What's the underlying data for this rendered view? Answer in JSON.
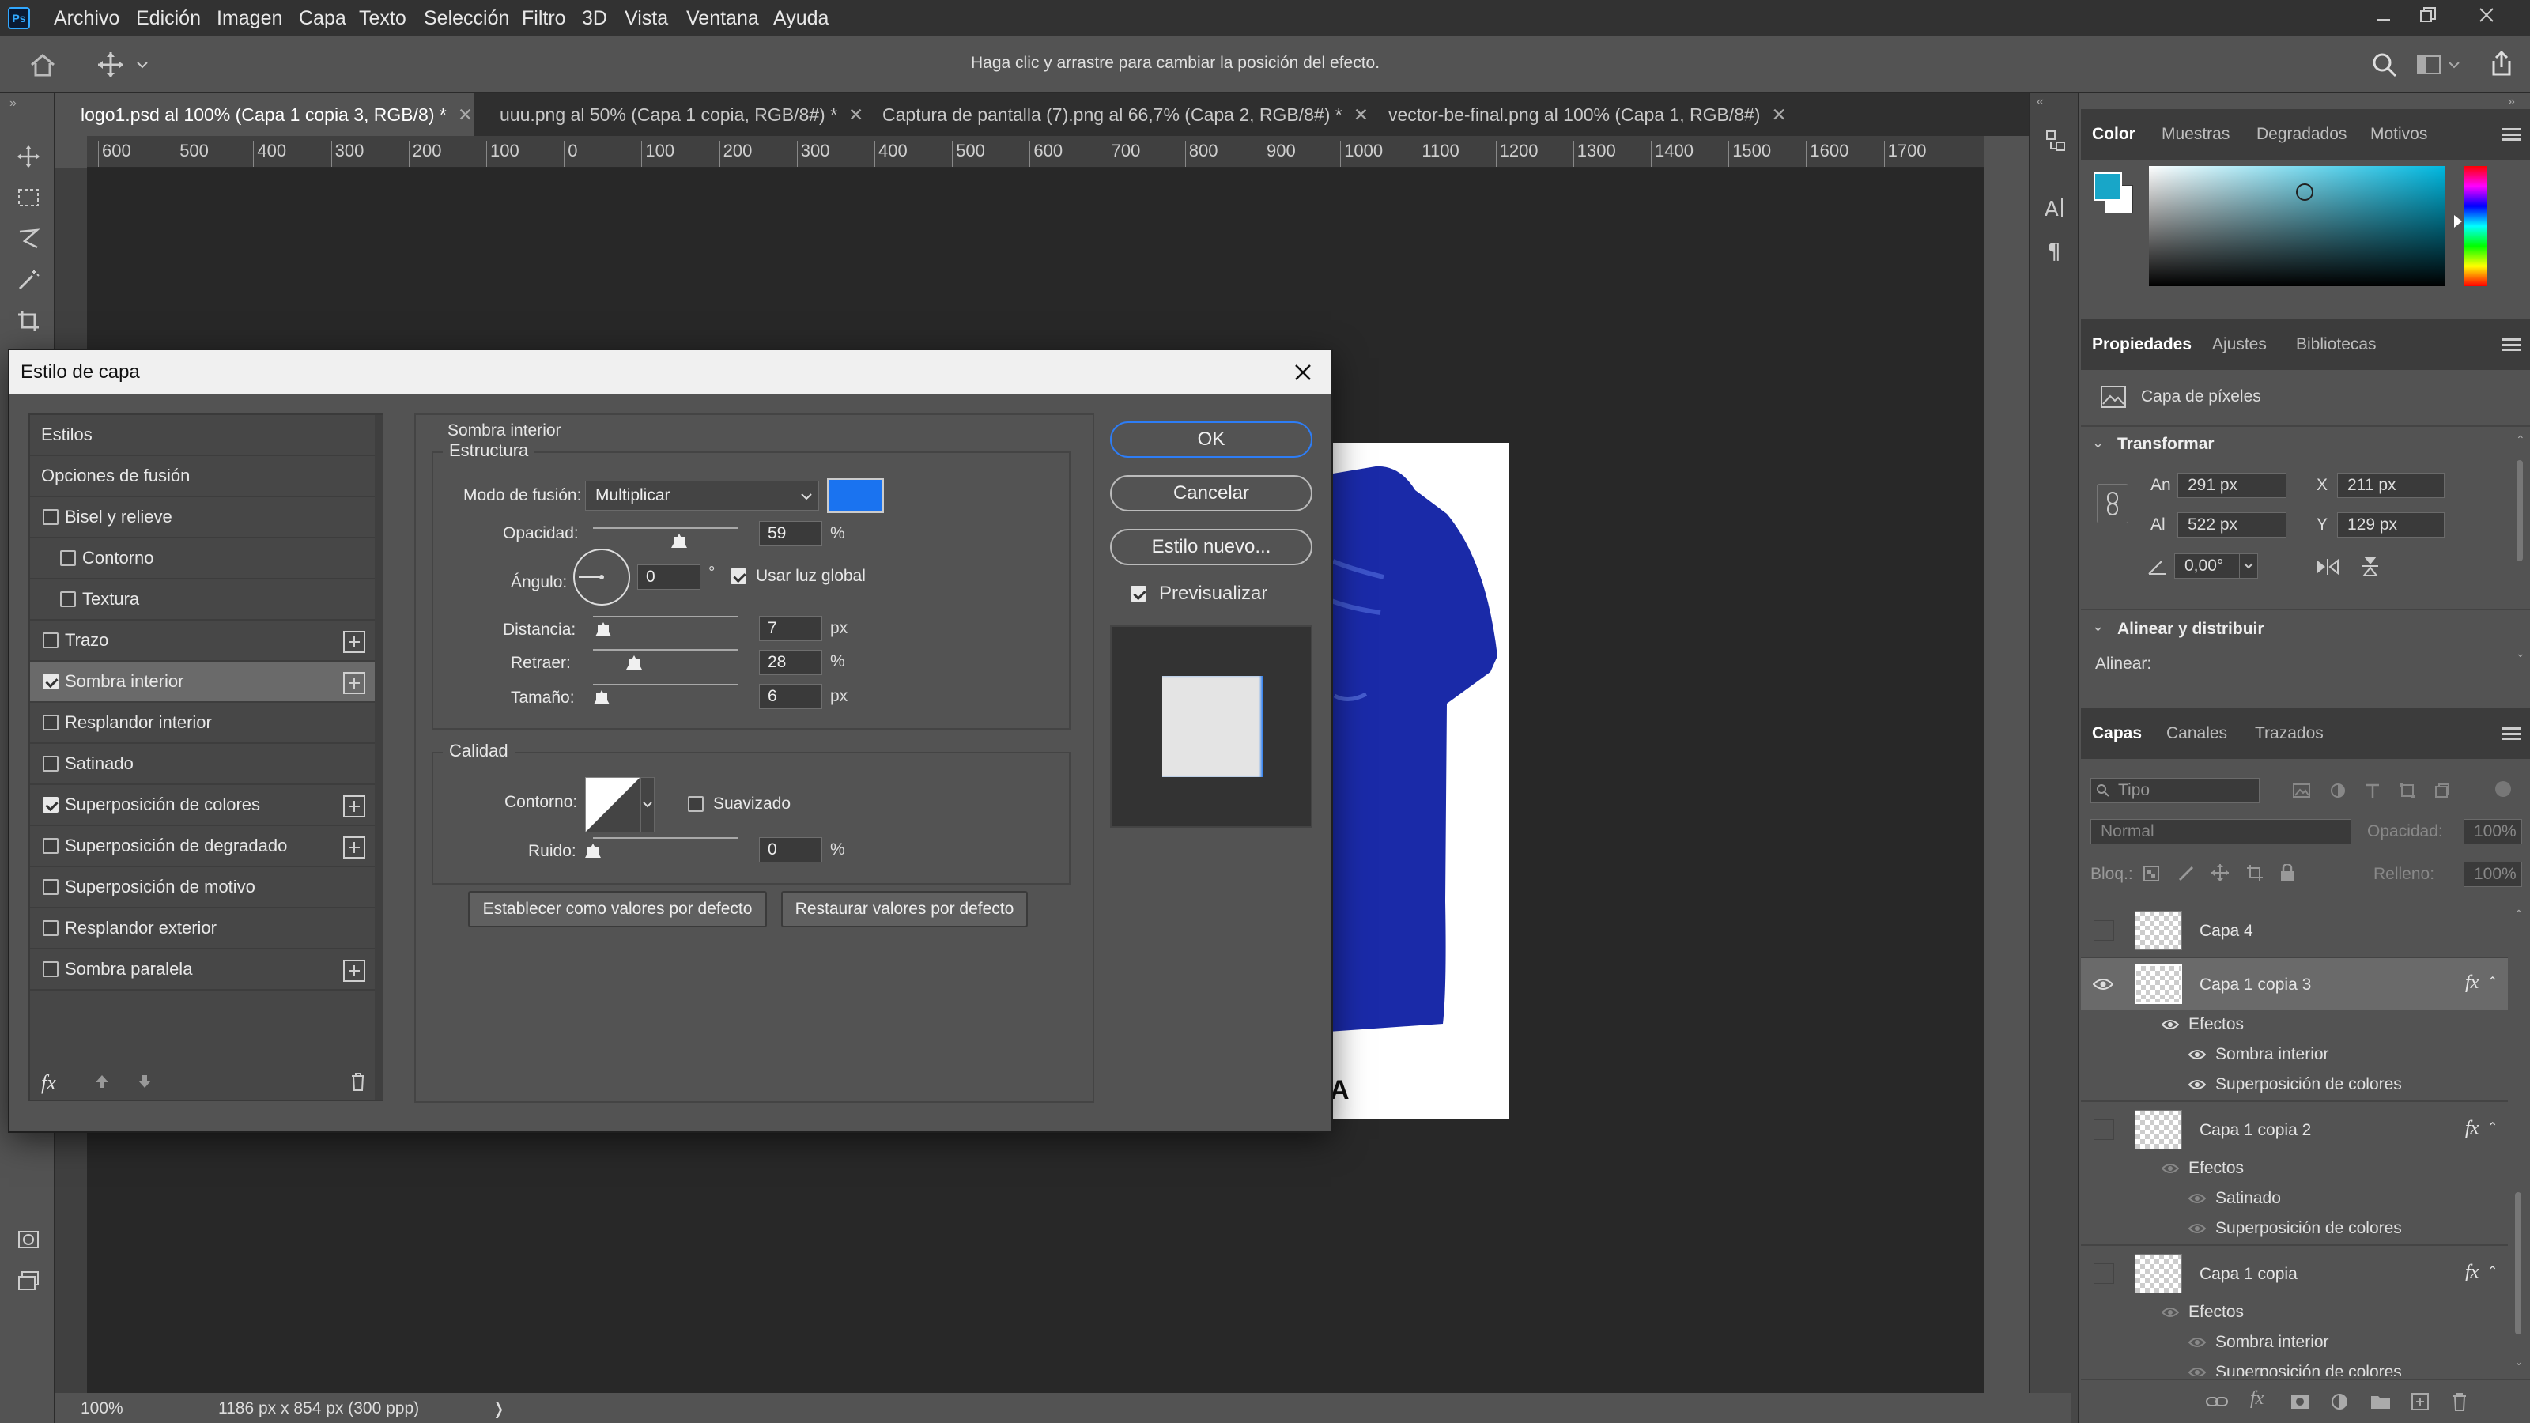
{
  "app": {
    "logo": "Ps"
  },
  "menu": [
    "Archivo",
    "Edición",
    "Imagen",
    "Capa",
    "Texto",
    "Selección",
    "Filtro",
    "3D",
    "Vista",
    "Ventana",
    "Ayuda"
  ],
  "optionsbar": {
    "hint": "Haga clic y arrastre para cambiar la posición del efecto."
  },
  "tabs": [
    "logo1.psd al 100% (Capa 1 copia 3, RGB/8) *",
    "uuu.png al 50% (Capa 1 copia, RGB/8#) *",
    "Captura de pantalla (7).png al 66,7% (Capa 2, RGB/8#) *",
    "vector-be-final.png al 100% (Capa 1, RGB/8#)"
  ],
  "ruler": {
    "h_labels": [
      "600",
      "500",
      "400",
      "300",
      "200",
      "100",
      "0",
      "100",
      "200",
      "300",
      "400",
      "500",
      "600",
      "700",
      "800",
      "900",
      "1000",
      "1100",
      "1200",
      "1300",
      "1400",
      "1500",
      "1600",
      "1700"
    ]
  },
  "status": {
    "zoom": "100%",
    "docinfo": "1186 px x 854 px (300 ppp)",
    "arrow": "❭"
  },
  "canvas_text": {
    "bottom": "A"
  },
  "color_panel": {
    "tabs": [
      "Color",
      "Muestras",
      "Degradados",
      "Motivos"
    ],
    "fg_color": "#18a6c8",
    "bg_color": "#ffffff"
  },
  "properties": {
    "tabs": [
      "Propiedades",
      "Ajustes",
      "Bibliotecas"
    ],
    "type_label": "Capa de píxeles",
    "transform_title": "Transformar",
    "an_label": "An",
    "an_value": "291 px",
    "x_label": "X",
    "x_value": "211 px",
    "al_label": "Al",
    "al_value": "522 px",
    "y_label": "Y",
    "y_value": "129 px",
    "angle_value": "0,00°",
    "align_title": "Alinear y distribuir",
    "align_label": "Alinear:"
  },
  "layers_panel": {
    "tabs": [
      "Capas",
      "Canales",
      "Trazados"
    ],
    "filter": "Tipo",
    "blend": "Normal",
    "opacity_label": "Opacidad:",
    "opacity_value": "100%",
    "lock_label": "Bloq.:",
    "fill_label": "Relleno:",
    "fill_value": "100%",
    "layers": [
      {
        "name": "Capa 4"
      },
      {
        "name": "Capa 1 copia 3",
        "effects_label": "Efectos",
        "effects": [
          "Sombra interior",
          "Superposición de colores"
        ]
      },
      {
        "name": "Capa 1 copia 2",
        "effects_label": "Efectos",
        "effects": [
          "Satinado",
          "Superposición de colores"
        ]
      },
      {
        "name": "Capa 1 copia",
        "effects_label": "Efectos",
        "effects": [
          "Sombra interior",
          "Superposición de colores"
        ]
      }
    ],
    "fx": "fx"
  },
  "dialog": {
    "title": "Estilo de capa",
    "styles_header": "Estilos",
    "blend_options": "Opciones de fusión",
    "styles": [
      {
        "label": "Bisel y relieve",
        "checked": false
      },
      {
        "label": "Contorno",
        "checked": false
      },
      {
        "label": "Textura",
        "checked": false
      },
      {
        "label": "Trazo",
        "checked": false
      },
      {
        "label": "Sombra interior",
        "checked": true
      },
      {
        "label": "Resplandor interior",
        "checked": false
      },
      {
        "label": "Satinado",
        "checked": false
      },
      {
        "label": "Superposición de colores",
        "checked": true
      },
      {
        "label": "Superposición de degradado",
        "checked": false
      },
      {
        "label": "Superposición de motivo",
        "checked": false
      },
      {
        "label": "Resplandor exterior",
        "checked": false
      },
      {
        "label": "Sombra paralela",
        "checked": false
      }
    ],
    "fx": "fx",
    "section_title": "Sombra interior",
    "structure": {
      "title": "Estructura",
      "blend_label": "Modo de fusión:",
      "blend_value": "Multiplicar",
      "color": "#1a73f0",
      "opacity_label": "Opacidad:",
      "opacity_value": "59",
      "opacity_unit": "%",
      "angle_label": "Ángulo:",
      "angle_value": "0",
      "angle_unit": "°",
      "global_light": "Usar luz global",
      "distance_label": "Distancia:",
      "distance_value": "7",
      "distance_unit": "px",
      "choke_label": "Retraer:",
      "choke_value": "28",
      "choke_unit": "%",
      "size_label": "Tamaño:",
      "size_value": "6",
      "size_unit": "px"
    },
    "quality": {
      "title": "Calidad",
      "contour_label": "Contorno:",
      "antialias": "Suavizado",
      "noise_label": "Ruido:",
      "noise_value": "0",
      "noise_unit": "%"
    },
    "set_default": "Establecer como valores por defecto",
    "reset_default": "Restaurar valores por defecto",
    "ok": "OK",
    "cancel": "Cancelar",
    "new_style": "Estilo nuevo...",
    "preview": "Previsualizar",
    "slider_levels": {
      "opacity": 0.59,
      "distance": 0.07,
      "choke": 0.28,
      "size": 0.06,
      "noise": 0.0
    }
  }
}
